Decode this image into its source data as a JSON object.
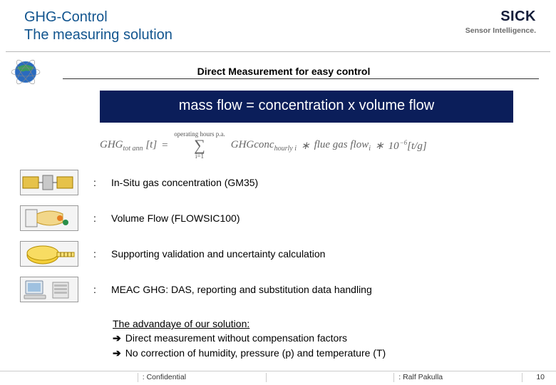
{
  "header": {
    "title_line1": "GHG-Control",
    "title_line2": "The measuring solution",
    "brand_name": "SICK",
    "brand_tag": "Sensor Intelligence."
  },
  "subtitle": "Direct Measurement for easy control",
  "formula_banner": "mass flow = concentration x volume flow",
  "equation": {
    "lhs": "GHG",
    "lhs_sub": "tot ann",
    "lhs_unit": "[t]",
    "eq": "=",
    "sum_top": "operating hours p.a.",
    "sum_bottom": "i=1",
    "term1": "GHGconc",
    "term1_sub": "hourly i",
    "star": "∗",
    "term2": "flue gas flow",
    "term2_sub": "i",
    "factor": "10",
    "factor_exp": "−6",
    "unit": "[t/g]"
  },
  "items": [
    {
      "label": "In-Situ gas concentration (GM35)"
    },
    {
      "label": "Volume Flow (FLOWSIC100)"
    },
    {
      "label": "Supporting validation and uncertainty calculation"
    },
    {
      "label": "MEAC GHG: DAS, reporting and substitution data handling"
    }
  ],
  "advantage": {
    "title": "The advandaye of our solution:",
    "line1": "Direct measurement without compensation factors",
    "line2": "No correction of humidity, pressure (p) and temperature (T)"
  },
  "footer": {
    "confidential": ": Confidential",
    "author": ": Ralf Pakulla",
    "page": "10"
  },
  "colors": {
    "title": "#12558f",
    "banner_bg": "#0b1e5a",
    "banner_fg": "#ffffff"
  }
}
